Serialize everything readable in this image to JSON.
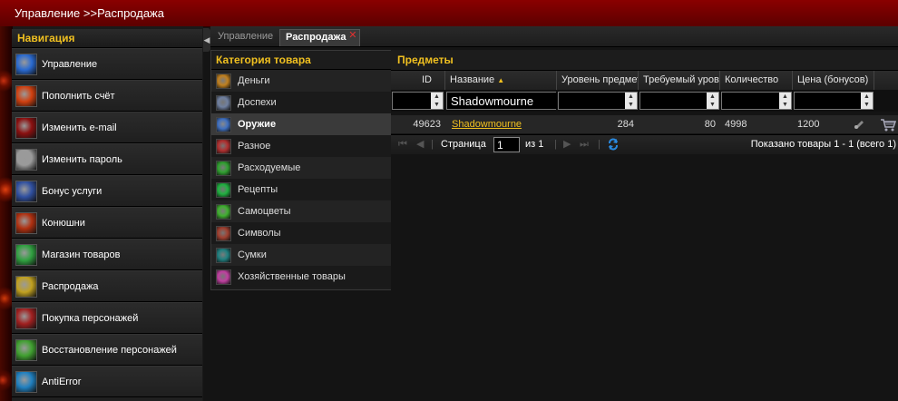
{
  "window": {
    "title": "Управление >>Распродажа"
  },
  "nav": {
    "title": "Навигация",
    "items": [
      {
        "label": "Управление",
        "icon": "portal-icon",
        "color": "#2a6ad0"
      },
      {
        "label": "Пополнить счёт",
        "icon": "fire-icon",
        "color": "#d04010"
      },
      {
        "label": "Изменить e-mail",
        "icon": "rune-icon",
        "color": "#8a1010"
      },
      {
        "label": "Изменить пароль",
        "icon": "skull-icon",
        "color": "#9a9a9a"
      },
      {
        "label": "Бонус услуги",
        "icon": "sword-icon",
        "color": "#3050a0"
      },
      {
        "label": "Конюшни",
        "icon": "horse-icon",
        "color": "#b03010"
      },
      {
        "label": "Магазин товаров",
        "icon": "orb-icon",
        "color": "#30a040"
      },
      {
        "label": "Распродажа",
        "icon": "star-icon",
        "color": "#c0a020"
      },
      {
        "label": "Покупка персонажей",
        "icon": "demon-icon",
        "color": "#a02020"
      },
      {
        "label": "Восстановление персонажей",
        "icon": "claw-icon",
        "color": "#40a030"
      },
      {
        "label": "AntiError",
        "icon": "swirl-icon",
        "color": "#2080c0"
      }
    ]
  },
  "tabs": [
    {
      "label": "Управление"
    },
    {
      "label": "Распродажа",
      "close": "✕"
    }
  ],
  "categories": {
    "title": "Категория товара",
    "items": [
      {
        "label": "Деньги",
        "icon": "coins-icon",
        "color": "#c08020"
      },
      {
        "label": "Доспехи",
        "icon": "armor-icon",
        "color": "#7080a0"
      },
      {
        "label": "Оружие",
        "icon": "weapon-icon",
        "color": "#4070c0",
        "selected": true
      },
      {
        "label": "Разное",
        "icon": "misc-icon",
        "color": "#b03030"
      },
      {
        "label": "Расходуемые",
        "icon": "potion-icon",
        "color": "#30a030"
      },
      {
        "label": "Рецепты",
        "icon": "recipe-icon",
        "color": "#20b040"
      },
      {
        "label": "Самоцветы",
        "icon": "gem-icon",
        "color": "#40b030"
      },
      {
        "label": "Символы",
        "icon": "glyph-icon",
        "color": "#a04030"
      },
      {
        "label": "Сумки",
        "icon": "bag-icon",
        "color": "#208080"
      },
      {
        "label": "Хозяйственные товары",
        "icon": "trade-goods-icon",
        "color": "#c040a0"
      }
    ]
  },
  "items": {
    "title": "Предметы",
    "columns": [
      "ID",
      "Название",
      "Уровень предмета",
      "Требуемый уровень",
      "Количество",
      "Цена (бонусов)"
    ],
    "sort_indicator": "▲",
    "filters": {
      "name_value": "Shadowmourne"
    },
    "rows": [
      {
        "id": "49623",
        "name": "Shadowmourne",
        "item_level": "284",
        "req_level": "80",
        "quantity": "4998",
        "price": "1200"
      }
    ],
    "pager": {
      "page_label": "Страница",
      "page_value": "1",
      "of_label": "из 1",
      "summary": "Показано товары 1 - 1 (всего 1)"
    }
  }
}
